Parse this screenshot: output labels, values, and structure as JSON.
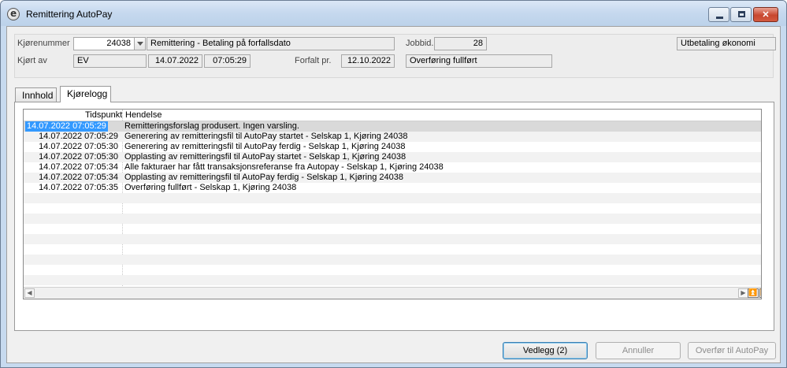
{
  "window": {
    "title": "Remittering AutoPay"
  },
  "header": {
    "kjorenummer_label": "Kjørenummer",
    "kjorenummer_value": "24038",
    "description": "Remittering - Betaling på forfallsdato",
    "jobbid_label": "Jobbid.",
    "jobbid_value": "28",
    "category": "Utbetaling økonomi",
    "kjort_av_label": "Kjørt av",
    "kjort_av_value": "EV",
    "run_date": "14.07.2022",
    "run_time": "07:05:29",
    "forfalt_label": "Forfalt pr.",
    "forfalt_value": "12.10.2022",
    "status": "Overføring fullført"
  },
  "tabs": [
    {
      "label": "Innhold",
      "active": false
    },
    {
      "label": "Kjørelogg",
      "active": true
    }
  ],
  "log": {
    "col_time": "Tidspunkt",
    "col_event": "Hendelse",
    "rows": [
      {
        "time": "14.07.2022 07:05:29",
        "event": "Remitteringsforslag produsert. Ingen varsling."
      },
      {
        "time": "14.07.2022 07:05:29",
        "event": "Generering av remitteringsfil til AutoPay startet - Selskap 1, Kjøring 24038"
      },
      {
        "time": "14.07.2022 07:05:30",
        "event": "Generering av remitteringsfil til AutoPay ferdig - Selskap 1, Kjøring 24038"
      },
      {
        "time": "14.07.2022 07:05:30",
        "event": "Opplasting av remitteringsfil til AutoPay startet - Selskap 1, Kjøring 24038"
      },
      {
        "time": "14.07.2022 07:05:34",
        "event": "Alle fakturaer har fått transaksjonsreferanse fra Autopay - Selskap 1, Kjøring 24038"
      },
      {
        "time": "14.07.2022 07:05:34",
        "event": "Opplasting av remitteringsfil til AutoPay ferdig - Selskap 1, Kjøring 24038"
      },
      {
        "time": "14.07.2022 07:05:35",
        "event": "Overføring fullført - Selskap 1, Kjøring 24038"
      }
    ]
  },
  "buttons": {
    "attachments": "Vedlegg (2)",
    "cancel": "Annuller",
    "transfer": "Overfør til AutoPay"
  }
}
